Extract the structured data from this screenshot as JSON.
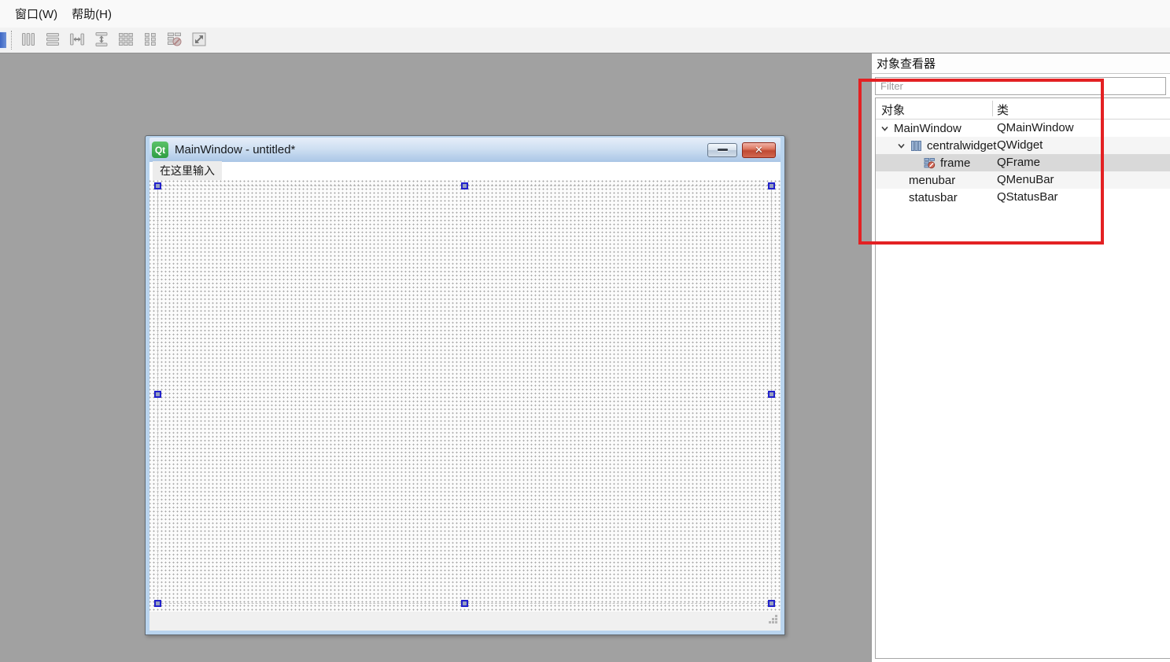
{
  "menu_bar": {
    "items": [
      {
        "label": "窗口(W)"
      },
      {
        "label": "帮助(H)"
      }
    ]
  },
  "toolbar": {
    "tools": [
      {
        "icon": "layout-horizontal-icon"
      },
      {
        "icon": "layout-vertical-icon"
      },
      {
        "icon": "layout-split-horizontal-icon"
      },
      {
        "icon": "layout-split-vertical-icon"
      },
      {
        "icon": "layout-grid-icon"
      },
      {
        "icon": "layout-form-icon"
      },
      {
        "icon": "break-layout-icon"
      },
      {
        "icon": "adjust-size-icon"
      }
    ]
  },
  "form_editor": {
    "window": {
      "badge": "Qt",
      "title": "MainWindow - untitled*",
      "menu_placeholder": "在这里输入"
    }
  },
  "object_inspector": {
    "title": "对象查看器",
    "filter_placeholder": "Filter",
    "columns": {
      "object": "对象",
      "class": "类"
    },
    "rows": [
      {
        "object": "MainWindow",
        "class": "QMainWindow"
      },
      {
        "object": "centralwidget",
        "class": "QWidget"
      },
      {
        "object": "frame",
        "class": "QFrame"
      },
      {
        "object": "menubar",
        "class": "QMenuBar"
      },
      {
        "object": "statusbar",
        "class": "QStatusBar"
      }
    ]
  },
  "annotation": {
    "highlight_color": "#e32123"
  },
  "colors": {
    "editor_background": "#a1a1a1",
    "selection_handle_border": "#2222cc",
    "selected_row": "#d9d9d9",
    "alternate_row": "#f5f5f5",
    "titlebar_gradient_top": "#e6eef9",
    "titlebar_gradient_bottom": "#aac6e6",
    "qt_badge_green": "#2f9e43"
  }
}
